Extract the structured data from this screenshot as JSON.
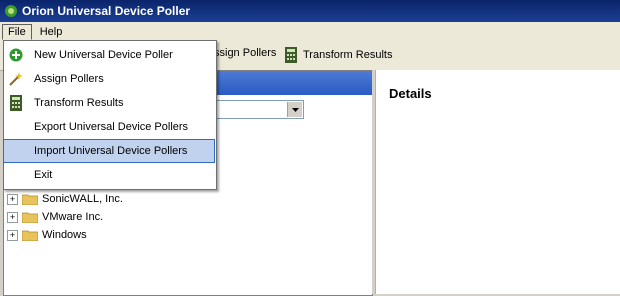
{
  "window": {
    "title": "Orion Universal Device Poller"
  },
  "menubar": {
    "file": "File",
    "help": "Help"
  },
  "toolbar": {
    "assign_pollers_partial": "ssign Pollers",
    "transform_results": "Transform Results"
  },
  "file_menu": {
    "items": [
      {
        "label": "New Universal Device Poller",
        "icon": "plus-icon"
      },
      {
        "label": "Assign Pollers",
        "icon": "wand-icon"
      },
      {
        "label": "Transform Results",
        "icon": "calculator-icon"
      },
      {
        "label": "Export Universal Device Pollers",
        "icon": ""
      },
      {
        "label": "Import Universal Device Pollers",
        "icon": ""
      },
      {
        "label": "Exit",
        "icon": ""
      }
    ]
  },
  "tree": {
    "nodes": [
      {
        "label": "SonicWALL, Inc."
      },
      {
        "label": "VMware Inc."
      },
      {
        "label": "Windows"
      }
    ]
  },
  "details": {
    "title": "Details"
  },
  "colors": {
    "title_bar": "#0a246a",
    "highlight": "#c8dc00",
    "pane_header": "#2a5bc4"
  }
}
